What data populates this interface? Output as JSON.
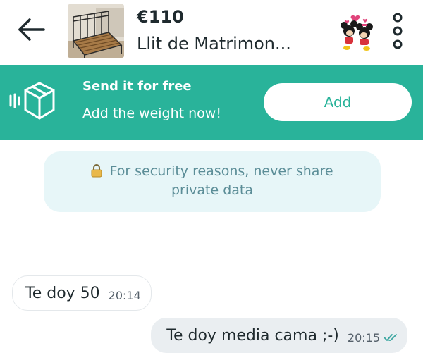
{
  "header": {
    "price": "€110",
    "title": "Llit de Matrimon...",
    "back_icon": "arrow-left-icon",
    "more_icon": "vertical-dots-icon"
  },
  "promo": {
    "title": "Send it for free",
    "subtitle": "Add the weight now!",
    "button_label": "Add",
    "icon": "box-icon",
    "background_color": "#29b39a"
  },
  "notice": {
    "line1": "For security reasons, never share",
    "line2": "private data",
    "icon": "lock-icon"
  },
  "messages": [
    {
      "direction": "incoming",
      "text": "Te doy 50",
      "time": "20:14"
    },
    {
      "direction": "outgoing",
      "text": "Te doy media cama ;-)",
      "time": "20:15",
      "status_icon": "double-check-icon"
    }
  ]
}
